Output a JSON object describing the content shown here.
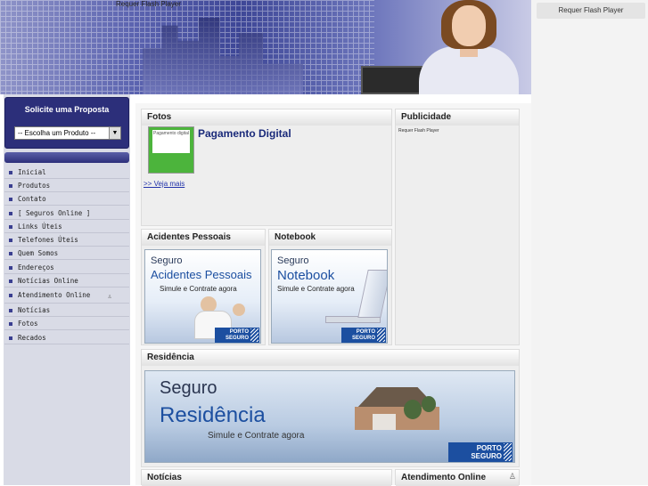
{
  "header": {
    "flash_text": "Requer Flash Player"
  },
  "right_sidebar": {
    "flash_text": "Requer Flash Player"
  },
  "proposal": {
    "title": "Solicite uma Proposta",
    "select_value": "-- Escolha um Produto --"
  },
  "menu": {
    "items": [
      {
        "label": "Inicial"
      },
      {
        "label": "Produtos"
      },
      {
        "label": "Contato"
      },
      {
        "label": "[ Seguros Online ]"
      },
      {
        "label": "Links Úteis"
      },
      {
        "label": "Telefones Úteis"
      },
      {
        "label": "Quem Somos"
      },
      {
        "label": "Endereços"
      },
      {
        "label": "Notícias Online"
      },
      {
        "label": "Atendimento Online"
      },
      {
        "label": "Notícias"
      },
      {
        "label": "Fotos"
      },
      {
        "label": "Recados"
      }
    ]
  },
  "fotos": {
    "heading": "Fotos",
    "item_title": "Pagamento Digital",
    "thumb_text": "Pagamento digital",
    "more_link": ">> Veja mais"
  },
  "publicidade": {
    "heading": "Publicidade",
    "flash_text": "Requer Flash Player"
  },
  "acidentes": {
    "heading": "Acidentes Pessoais",
    "banner_line1": "Seguro",
    "banner_line2": "Acidentes Pessoais",
    "banner_line3": "Simule e Contrate agora",
    "logo_line1": "PORTO",
    "logo_line2": "SEGURO"
  },
  "notebook": {
    "heading": "Notebook",
    "banner_line1": "Seguro",
    "banner_line2": "Notebook",
    "banner_line3": "Simule e Contrate agora",
    "logo_line1": "PORTO",
    "logo_line2": "SEGURO"
  },
  "residencia": {
    "heading": "Residência",
    "banner_line1": "Seguro",
    "banner_line2": "Residência",
    "banner_line3": "Simule e Contrate agora",
    "logo_line1": "PORTO",
    "logo_line2": "SEGURO"
  },
  "noticias": {
    "heading": "Notícias"
  },
  "atendimento": {
    "heading": "Atendimento Online"
  },
  "icons": {
    "menu_bullet": "square-bullet-icon",
    "select_arrow": "chevron-down-icon",
    "online_status": "person-icon"
  },
  "colors": {
    "menu_dark": "#2c2f7a",
    "link_blue": "#2233aa",
    "porto_blue": "#1c4fa0"
  }
}
